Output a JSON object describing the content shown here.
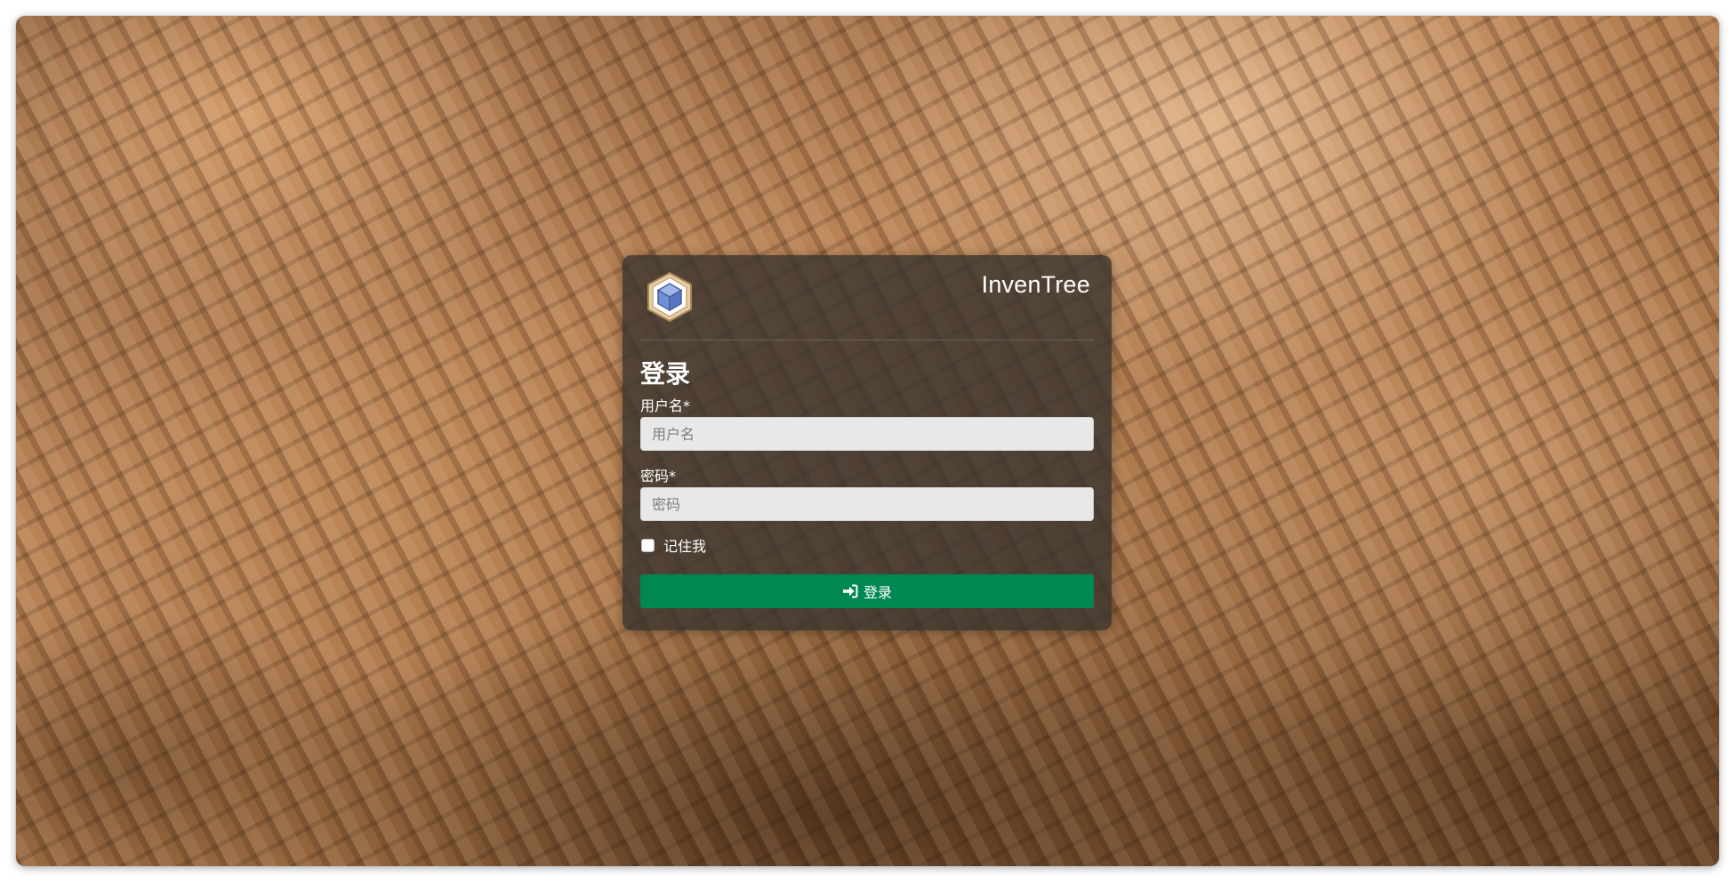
{
  "brand": {
    "name": "InvenTree"
  },
  "login": {
    "title": "登录",
    "username_label": "用户名*",
    "username_placeholder": "用户名",
    "password_label": "密码*",
    "password_placeholder": "密码",
    "remember_label": "记住我",
    "remember_checked": false,
    "submit_label": "登录"
  },
  "colors": {
    "submit_button": "#008752",
    "card_background": "rgba(55,50,45,0.80)",
    "input_background": "#e8e8e8"
  },
  "icons": {
    "logo": "inventree-cube-logo",
    "submit": "sign-in-icon"
  }
}
